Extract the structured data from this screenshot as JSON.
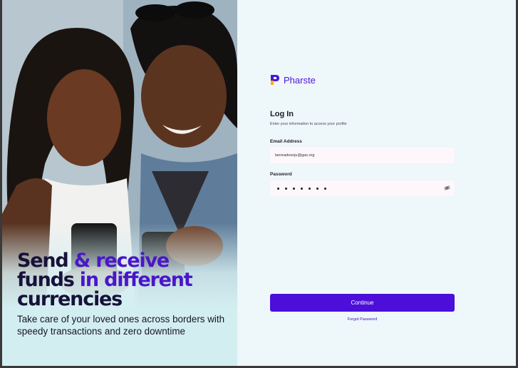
{
  "hero": {
    "headline_line1_a": "Send",
    "headline_line1_b": "&",
    "headline_line1_c": "receive",
    "headline_line2_a": "funds",
    "headline_line2_b": "in different",
    "headline_line3": "currencies",
    "subtitle": "Take care of your loved ones across borders with speedy transactions and zero downtime"
  },
  "brand": {
    "name": "Pharste",
    "color": "#4c17d6"
  },
  "login": {
    "title": "Log In",
    "subtitle": "Enter your information to access your profile",
    "email_label": "Email Address",
    "email_value": "lanreadesoju@gas.org",
    "password_label": "Password",
    "password_dot_count": 7,
    "continue_label": "Continue",
    "forgot_label": "Forgot Password"
  },
  "colors": {
    "accent": "#4c0fd9",
    "panel_bg": "#eef7fa",
    "field_bg": "#fdf7fc",
    "headline_dark": "#16123a",
    "headline_accent": "#4a16c9"
  },
  "icons": {
    "password_toggle": "eye-off-icon",
    "brand": "pharste-logo-icon"
  }
}
